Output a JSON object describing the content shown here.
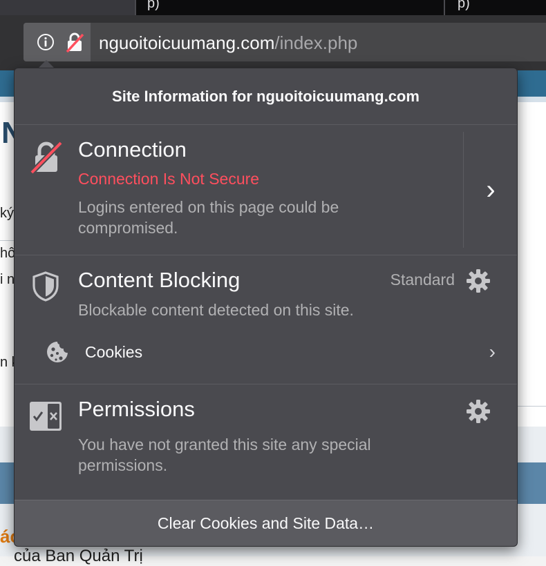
{
  "browser": {
    "tab_fragments": [
      "p)",
      "p)"
    ],
    "url": {
      "domain": "nguoitoicuumang.com",
      "path": "/index.php"
    },
    "icons": {
      "info": "info-icon",
      "insecure_lock": "insecure-lock-icon"
    }
  },
  "background_page": {
    "fragments": [
      "N",
      "ký",
      "hô",
      "i n",
      "n k",
      "ác",
      "của Ban Quản Trị"
    ]
  },
  "popup": {
    "title": "Site Information for nguoitoicuumang.com",
    "connection": {
      "title": "Connection",
      "status": "Connection Is Not Secure",
      "description": "Logins entered on this page could be compromised.",
      "expand_glyph": "›",
      "icon": "broken-lock-icon"
    },
    "content_blocking": {
      "title": "Content Blocking",
      "level": "Standard",
      "description": "Blockable content detected on this site.",
      "icon": "shield-icon",
      "settings_icon": "gear-icon",
      "items": [
        {
          "label": "Cookies",
          "icon": "cookie-icon",
          "chevron": "›"
        }
      ]
    },
    "permissions": {
      "title": "Permissions",
      "description": "You have not granted this site any special permissions.",
      "icon": "permissions-icon",
      "settings_icon": "gear-icon"
    },
    "footer_button": "Clear Cookies and Site Data…"
  },
  "colors": {
    "popup_bg": "#4a4a4f",
    "footer_bg": "#5b5b60",
    "warning": "#ff4f5e",
    "secondary_text": "#b1b1b3",
    "primary_text": "#f9f9fa"
  }
}
